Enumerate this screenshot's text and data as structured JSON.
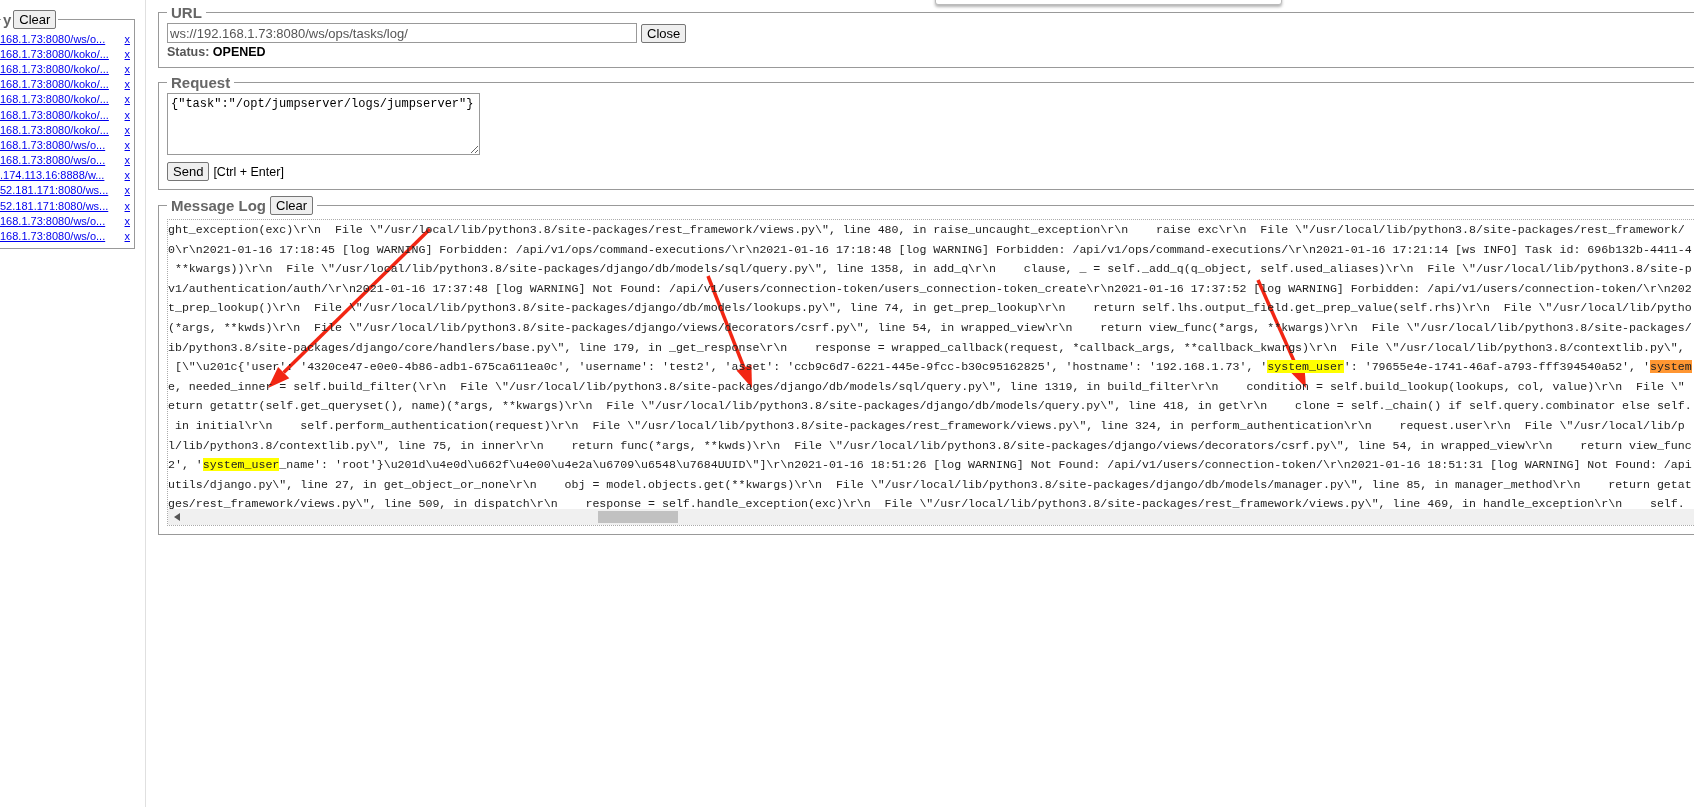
{
  "history": {
    "legend": "y",
    "clear_button": "Clear",
    "items": [
      {
        "url": "168.1.73:8080/ws/o...",
        "remove": "x"
      },
      {
        "url": "168.1.73:8080/koko/...",
        "remove": "x"
      },
      {
        "url": "168.1.73:8080/koko/...",
        "remove": "x"
      },
      {
        "url": "168.1.73:8080/koko/...",
        "remove": "x"
      },
      {
        "url": "168.1.73:8080/koko/...",
        "remove": "x"
      },
      {
        "url": "168.1.73:8080/koko/...",
        "remove": "x"
      },
      {
        "url": "168.1.73:8080/koko/...",
        "remove": "x"
      },
      {
        "url": "168.1.73:8080/ws/o...",
        "remove": "x"
      },
      {
        "url": "168.1.73:8080/ws/o...",
        "remove": "x"
      },
      {
        "url": ".174.113.16:8888/w...",
        "remove": "x"
      },
      {
        "url": "52.181.171:8080/ws...",
        "remove": "x"
      },
      {
        "url": "52.181.171:8080/ws...",
        "remove": "x"
      },
      {
        "url": "168.1.73:8080/ws/o...",
        "remove": "x"
      },
      {
        "url": "168.1.73:8080/ws/o...",
        "remove": "x"
      }
    ]
  },
  "url_panel": {
    "legend": "URL",
    "url_value": "ws://192.168.1.73:8080/ws/ops/tasks/log/",
    "close_button": "Close",
    "status_label": "Status:",
    "status_value": "OPENED"
  },
  "request_panel": {
    "legend": "Request",
    "body": "{\"task\":\"/opt/jumpserver/logs/jumpserver\"}",
    "send_button": "Send",
    "shortcut": "[Ctrl + Enter]"
  },
  "message_log": {
    "legend": "Message Log",
    "clear_button": "Clear",
    "lines": [
      {
        "segments": [
          {
            "text": "ght_exception(exc)\\r\\n  File \\\"/usr/local/lib/python3.8/site-packages/rest_framework/views.py\\\", line 480, in raise_uncaught_exception\\r\\n    raise exc\\r\\n  File \\\"/usr/local/lib/python3.8/site-packages/rest_framework/",
            "highlighted": false,
            "current": false
          }
        ]
      },
      {
        "segments": [
          {
            "text": "0\\r\\n2021-01-16 17:18:45 [log WARNING] Forbidden: /api/v1/ops/command-executions/\\r\\n2021-01-16 17:18:48 [log WARNING] Forbidden: /api/v1/ops/command-executions/\\r\\n2021-01-16 17:21:14 [ws INFO] Task id: 696b132b-4411-4",
            "highlighted": false,
            "current": false
          }
        ]
      },
      {
        "segments": [
          {
            "text": " **kwargs))\\r\\n  File \\\"/usr/local/lib/python3.8/site-packages/django/db/models/sql/query.py\\\", line 1358, in add_q\\r\\n    clause, _ = self._add_q(q_object, self.used_aliases)\\r\\n  File \\\"/usr/local/lib/python3.8/site-p",
            "highlighted": false,
            "current": false
          }
        ]
      },
      {
        "segments": [
          {
            "text": "v1/authentication/auth/\\r\\n2021-01-16 17:37:48 [log WARNING] Not Found: /api/v1/users/connection-token/users_connection-token_create\\r\\n2021-01-16 17:37:52 [log WARNING] Forbidden: /api/v1/users/connection-token/\\r\\n202",
            "highlighted": false,
            "current": false
          }
        ]
      },
      {
        "segments": [
          {
            "text": "t_prep_lookup()\\r\\n  File \\\"/usr/local/lib/python3.8/site-packages/django/db/models/lookups.py\\\", line 74, in get_prep_lookup\\r\\n    return self.lhs.output_field.get_prep_value(self.rhs)\\r\\n  File \\\"/usr/local/lib/pytho",
            "highlighted": false,
            "current": false
          }
        ]
      },
      {
        "segments": [
          {
            "text": "(*args, **kwds)\\r\\n  File \\\"/usr/local/lib/python3.8/site-packages/django/views/decorators/csrf.py\\\", line 54, in wrapped_view\\r\\n    return view_func(*args, **kwargs)\\r\\n  File \\\"/usr/local/lib/python3.8/site-packages/",
            "highlighted": false,
            "current": false
          }
        ]
      },
      {
        "segments": [
          {
            "text": "ib/python3.8/site-packages/django/core/handlers/base.py\\\", line 179, in _get_response\\r\\n    response = wrapped_callback(request, *callback_args, **callback_kwargs)\\r\\n  File \\\"/usr/local/lib/python3.8/contextlib.py\\\",",
            "highlighted": false,
            "current": false
          }
        ]
      },
      {
        "segments": [
          {
            "text": " [\\\"\\u201c{'user': '4320ce47-e0e0-4b86-adb1-675ca611ea0c', 'username': 'test2', 'asset': 'ccb9c6d7-6221-445e-9fcc-b30c95162825', 'hostname': '192.168.1.73', '",
            "highlighted": false,
            "current": false
          },
          {
            "text": "system_user",
            "highlighted": true,
            "current": false
          },
          {
            "text": "': '79655e4e-1741-46af-a793-fff394540a52', '",
            "highlighted": false,
            "current": false
          },
          {
            "text": "system",
            "highlighted": true,
            "current": true
          }
        ]
      },
      {
        "segments": [
          {
            "text": "e, needed_inner = self.build_filter(\\r\\n  File \\\"/usr/local/lib/python3.8/site-packages/django/db/models/sql/query.py\\\", line 1319, in build_filter\\r\\n    condition = self.build_lookup(lookups, col, value)\\r\\n  File \\\"",
            "highlighted": false,
            "current": false
          }
        ]
      },
      {
        "segments": [
          {
            "text": "eturn getattr(self.get_queryset(), name)(*args, **kwargs)\\r\\n  File \\\"/usr/local/lib/python3.8/site-packages/django/db/models/query.py\\\", line 418, in get\\r\\n    clone = self._chain() if self.query.combinator else self.",
            "highlighted": false,
            "current": false
          }
        ]
      },
      {
        "segments": [
          {
            "text": " in initial\\r\\n    self.perform_authentication(request)\\r\\n  File \\\"/usr/local/lib/python3.8/site-packages/rest_framework/views.py\\\", line 324, in perform_authentication\\r\\n    request.user\\r\\n  File \\\"/usr/local/lib/p",
            "highlighted": false,
            "current": false
          }
        ]
      },
      {
        "segments": [
          {
            "text": "l/lib/python3.8/contextlib.py\\\", line 75, in inner\\r\\n    return func(*args, **kwds)\\r\\n  File \\\"/usr/local/lib/python3.8/site-packages/django/views/decorators/csrf.py\\\", line 54, in wrapped_view\\r\\n    return view_func",
            "highlighted": false,
            "current": false
          }
        ]
      },
      {
        "segments": [
          {
            "text": "2', '",
            "highlighted": false,
            "current": false
          },
          {
            "text": "system_user",
            "highlighted": true,
            "current": false
          },
          {
            "text": "_name': 'root'}\\u201d\\u4e0d\\u662f\\u4e00\\u4e2a\\u6709\\u6548\\u7684UUID\\\"]\\r\\n2021-01-16 18:51:26 [log WARNING] Not Found: /api/v1/users/connection-token/\\r\\n2021-01-16 18:51:31 [log WARNING] Not Found: /api",
            "highlighted": false,
            "current": false
          }
        ]
      },
      {
        "segments": [
          {
            "text": "utils/django.py\\\", line 27, in get_object_or_none\\r\\n    obj = model.objects.get(**kwargs)\\r\\n  File \\\"/usr/local/lib/python3.8/site-packages/django/db/models/manager.py\\\", line 85, in manager_method\\r\\n    return getat",
            "highlighted": false,
            "current": false
          }
        ]
      },
      {
        "segments": [
          {
            "text": "ges/rest_framework/views.py\\\", line 509, in dispatch\\r\\n    response = self.handle_exception(exc)\\r\\n  File \\\"/usr/local/lib/python3.8/site-packages/rest_framework/views.py\\\", line 469, in handle_exception\\r\\n    self.",
            "highlighted": false,
            "current": false
          }
        ]
      }
    ]
  }
}
